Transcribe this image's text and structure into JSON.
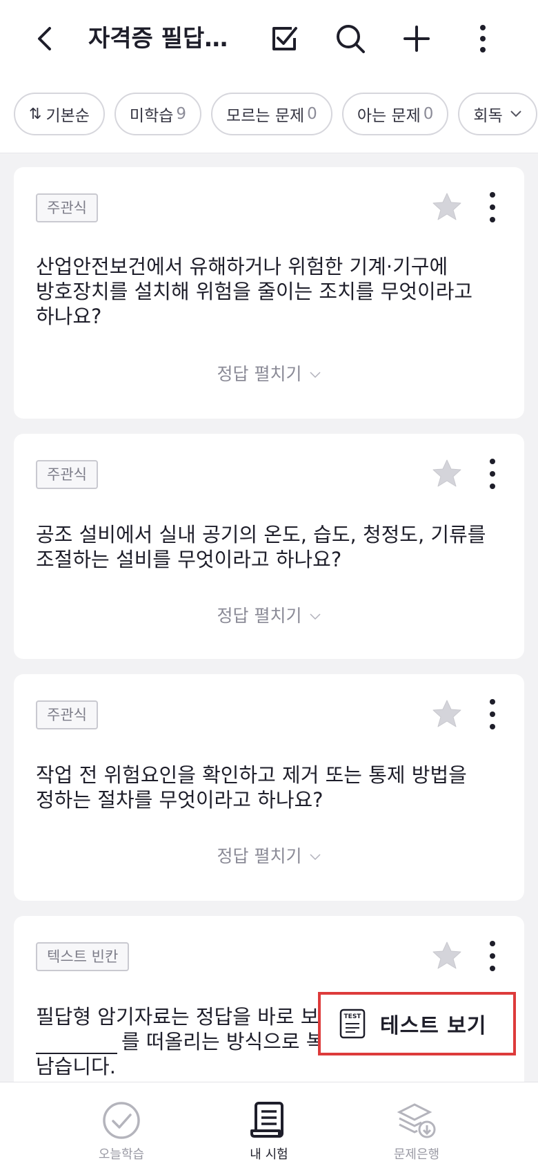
{
  "header": {
    "title": "자격증 필답…",
    "icons": {
      "back": "chevron-left-icon",
      "check": "checkbox-icon",
      "search": "search-icon",
      "add": "plus-icon",
      "more": "more-vertical-icon"
    }
  },
  "filters": {
    "sort_label": "기본순",
    "unlearned_label": "미학습",
    "unlearned_count": "9",
    "unknown_label": "모르는 문제",
    "unknown_count": "0",
    "known_label": "아는 문제",
    "known_count": "0",
    "round_label": "회독"
  },
  "cards": [
    {
      "type": "주관식",
      "question": "산업안전보건에서 유해하거나 위험한 기계·기구에 방호장치를 설치해 위험을 줄이는 조치를 무엇이라고 하나요?",
      "reveal": "정답 펼치기"
    },
    {
      "type": "주관식",
      "question": "공조 설비에서 실내 공기의 온도, 습도, 청정도, 기류를 조절하는 설비를 무엇이라고 하나요?",
      "reveal": "정답 펼치기"
    },
    {
      "type": "주관식",
      "question": "작업 전 위험요인을 확인하고 제거 또는 통제 방법을 정하는 절차를 무엇이라고 하나요?",
      "reveal": "정답 펼치기"
    },
    {
      "type": "텍스트 빈칸",
      "question_line1": "필답형 암기자료는 정답을 바로 보",
      "question_line2": "를 떠올리는 방식으로 복",
      "question_line3": "남습니다."
    }
  ],
  "fab": {
    "icon_text": "TEST",
    "label": "테스트 보기"
  },
  "bottom_nav": {
    "today": "오늘학습",
    "mine": "내 시험",
    "bank": "문제은행"
  },
  "colors": {
    "accent_outline": "#dd3b3b",
    "text_primary": "#1e1e2a",
    "background": "#f2f2f4"
  }
}
